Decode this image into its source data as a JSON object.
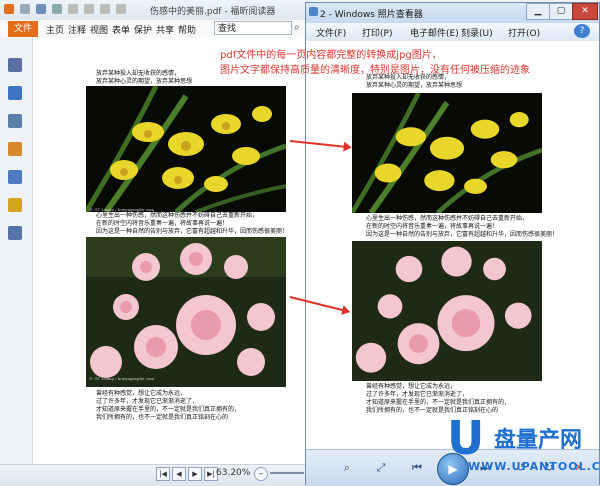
{
  "reader": {
    "title": "伤感中的美丽.pdf - 福昕阅读器",
    "file_tab": "文件",
    "menu": [
      "主页",
      "注释",
      "视图",
      "表单",
      "保护",
      "共享",
      "帮助"
    ],
    "search_placeholder": "查找",
    "zoom": "63.20%"
  },
  "viewer": {
    "title": "2 - Windows 照片查看器",
    "toolbar": [
      "文件(F)",
      "打印(P)",
      "电子邮件(E)",
      "刻录(U)",
      "打开(O)"
    ]
  },
  "annotation": {
    "line1": "pdf文件中的每一页内容都完整的转换成jpg图片，",
    "line2": "图片文字都保持高质量的清晰度，特别是图片，没有任何被压缩的迹象"
  },
  "page": {
    "top_lines": [
      "放弃某种投入却无收获的感情，",
      "放弃某种心灵的期望，放弃某种思想"
    ],
    "middle_lines": [
      "心里生出一种伤感，然而这种伤感并不妨碍自己去重新开始，",
      "在新的时空内将音乐重奏一遍，将故事再说一遍！",
      "因为这是一种自然的告别与放弃，它富有超越和升华，因而伤感很美丽！"
    ],
    "bottom_lines": [
      "曾经有种感觉，想让它成为永远，",
      "过了许多年，才发现它已渐渐消逝了，",
      "才知道原来握在手里的，不一定就是我们真正拥有的，",
      "我们所拥有的，也不一定就是我们真正铭刻在心的"
    ],
    "photo_credit": "© GT Lonny / bonyagraphe.com"
  },
  "watermark": {
    "letter": "U",
    "brand": "盘量产网",
    "sub": "WWW.UPANTOOL.COM"
  }
}
